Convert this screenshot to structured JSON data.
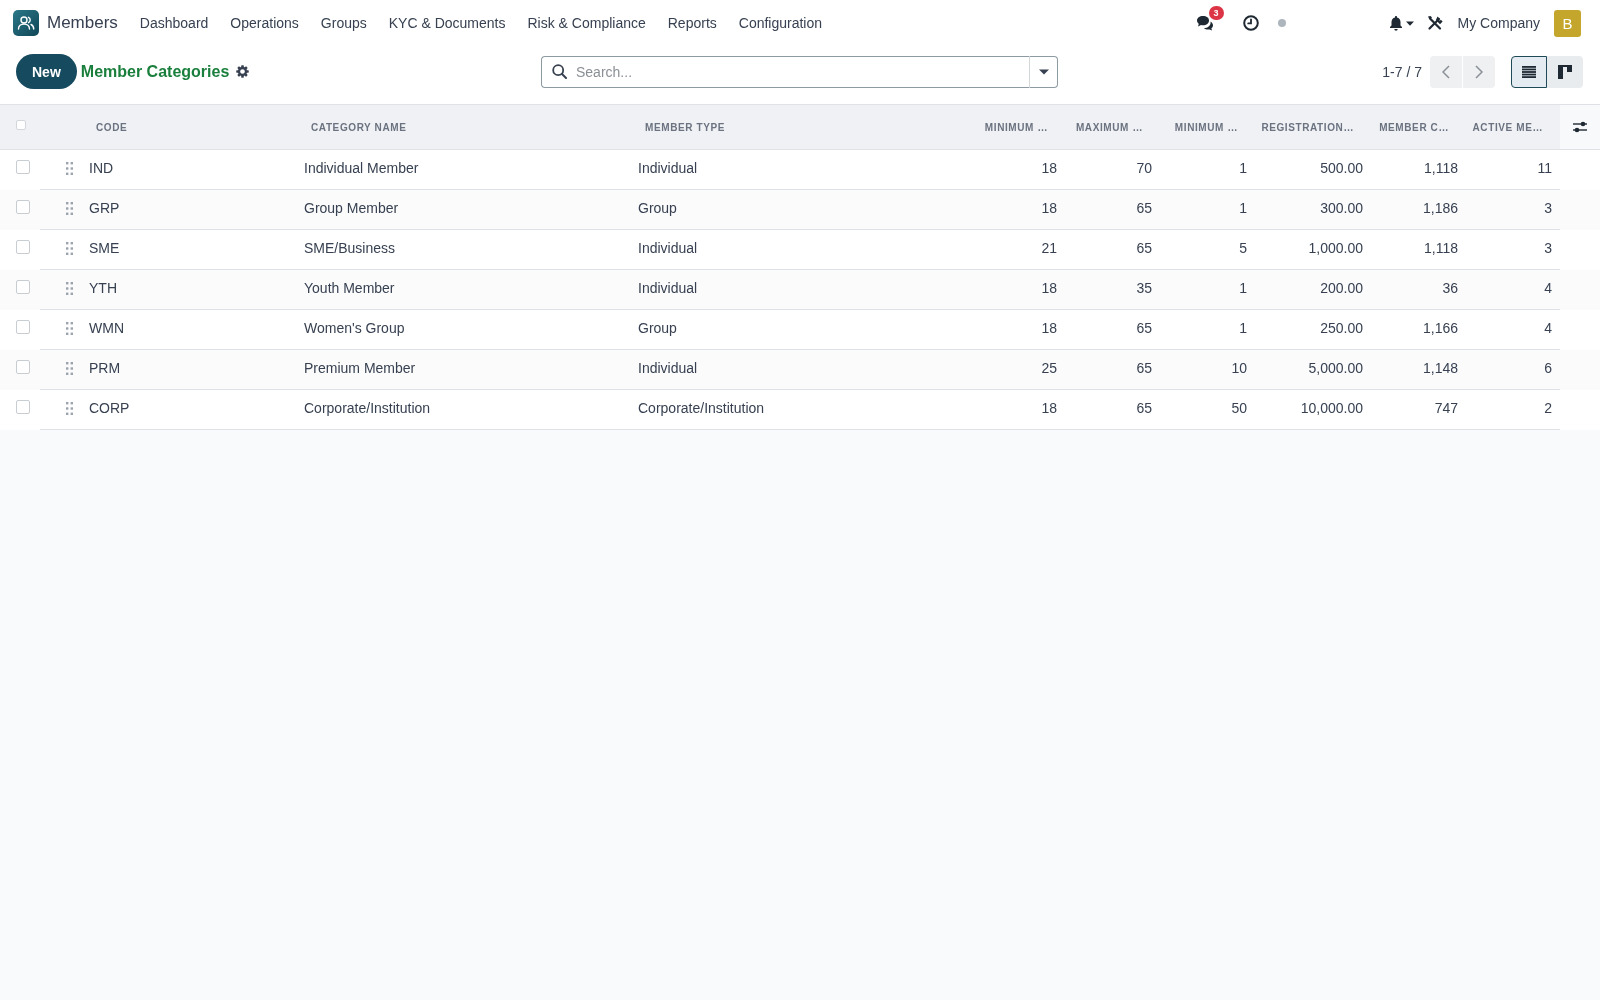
{
  "app": {
    "name": "Members"
  },
  "menu": [
    "Dashboard",
    "Operations",
    "Groups",
    "KYC & Documents",
    "Risk & Compliance",
    "Reports",
    "Configuration"
  ],
  "systray": {
    "message_count": "3",
    "company": "My Company",
    "avatar_letter": "B"
  },
  "control_panel": {
    "new_button": "New",
    "title": "Member Categories",
    "search": {
      "placeholder": "Search..."
    },
    "pager": "1-7 / 7",
    "views": [
      {
        "kind": "list",
        "selected": true
      },
      {
        "kind": "kanban",
        "selected": false
      }
    ]
  },
  "table": {
    "select_all": {
      "checked": false
    },
    "columns": [
      {
        "label": "CODE",
        "kind": "text"
      },
      {
        "label": "CATEGORY NAME",
        "kind": "text"
      },
      {
        "label": "MEMBER TYPE",
        "kind": "text"
      },
      {
        "label": "MINIMUM …",
        "kind": "number"
      },
      {
        "label": "MAXIMUM …",
        "kind": "number"
      },
      {
        "label": "MINIMUM …",
        "kind": "number"
      },
      {
        "label": "REGISTRATION…",
        "kind": "number"
      },
      {
        "label": "MEMBER C…",
        "kind": "number"
      },
      {
        "label": "ACTIVE ME…",
        "kind": "number"
      }
    ],
    "rows": [
      {
        "checked": false,
        "cells": [
          "IND",
          "Individual Member",
          "Individual",
          "18",
          "70",
          "1",
          "500.00",
          "1,118",
          "11"
        ]
      },
      {
        "checked": false,
        "cells": [
          "GRP",
          "Group Member",
          "Group",
          "18",
          "65",
          "1",
          "300.00",
          "1,186",
          "3"
        ]
      },
      {
        "checked": false,
        "cells": [
          "SME",
          "SME/Business",
          "Individual",
          "21",
          "65",
          "5",
          "1,000.00",
          "1,118",
          "3"
        ]
      },
      {
        "checked": false,
        "cells": [
          "YTH",
          "Youth Member",
          "Individual",
          "18",
          "35",
          "1",
          "200.00",
          "36",
          "4"
        ]
      },
      {
        "checked": false,
        "cells": [
          "WMN",
          "Women's Group",
          "Group",
          "18",
          "65",
          "1",
          "250.00",
          "1,166",
          "4"
        ]
      },
      {
        "checked": false,
        "cells": [
          "PRM",
          "Premium Member",
          "Individual",
          "25",
          "65",
          "10",
          "5,000.00",
          "1,148",
          "6"
        ]
      },
      {
        "checked": false,
        "cells": [
          "CORP",
          "Corporate/Institution",
          "Corporate/Institution",
          "18",
          "65",
          "50",
          "10,000.00",
          "747",
          "2"
        ]
      }
    ]
  }
}
